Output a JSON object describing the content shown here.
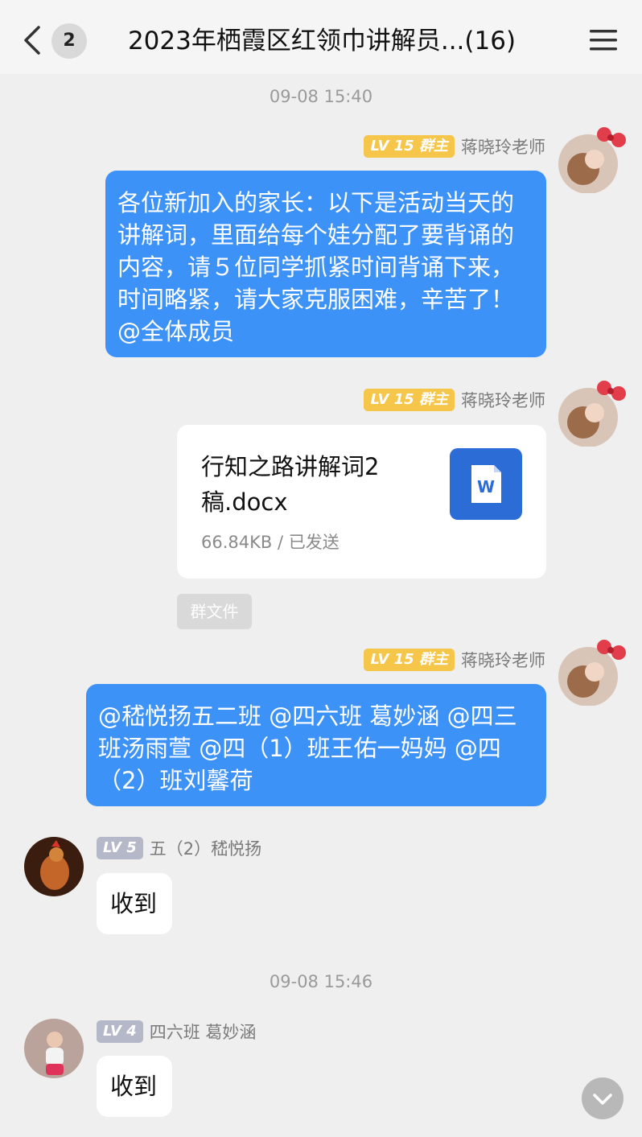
{
  "header": {
    "title": "2023年栖霞区红领巾讲解员...(16)",
    "unread_count": "2"
  },
  "timestamps": [
    "09-08 15:40",
    "09-08 15:46"
  ],
  "messages": [
    {
      "sender": "蒋晓玲老师",
      "level": "LV 15",
      "role": "群主",
      "text": "各位新加入的家长：以下是活动当天的讲解词，里面给每个娃分配了要背诵的内容，请５位同学抓紧时间背诵下来，时间略紧，请大家克服困难，辛苦了！@全体成员"
    },
    {
      "sender": "蒋晓玲老师",
      "level": "LV 15",
      "role": "群主",
      "file": {
        "name": "行知之路讲解词2稿.docx",
        "meta": "66.84KB / 已发送",
        "tag": "群文件",
        "icon": "word-doc-icon"
      }
    },
    {
      "sender": "蒋晓玲老师",
      "level": "LV 15",
      "role": "群主",
      "text": "@嵇悦扬五二班 @四六班 葛妙涵 @四三班汤雨萱 @四（1）班王佑一妈妈 @四（2）班刘馨荷"
    },
    {
      "sender": "五（2）嵇悦扬",
      "level": "LV 5",
      "text": "收到"
    },
    {
      "sender": "四六班 葛妙涵",
      "level": "LV 4",
      "text": "收到"
    }
  ],
  "colors": {
    "own_bubble": "#3d92f7",
    "owner_badge": "#f5c64a",
    "member_badge": "#b5b8c8",
    "background": "#efefef"
  }
}
